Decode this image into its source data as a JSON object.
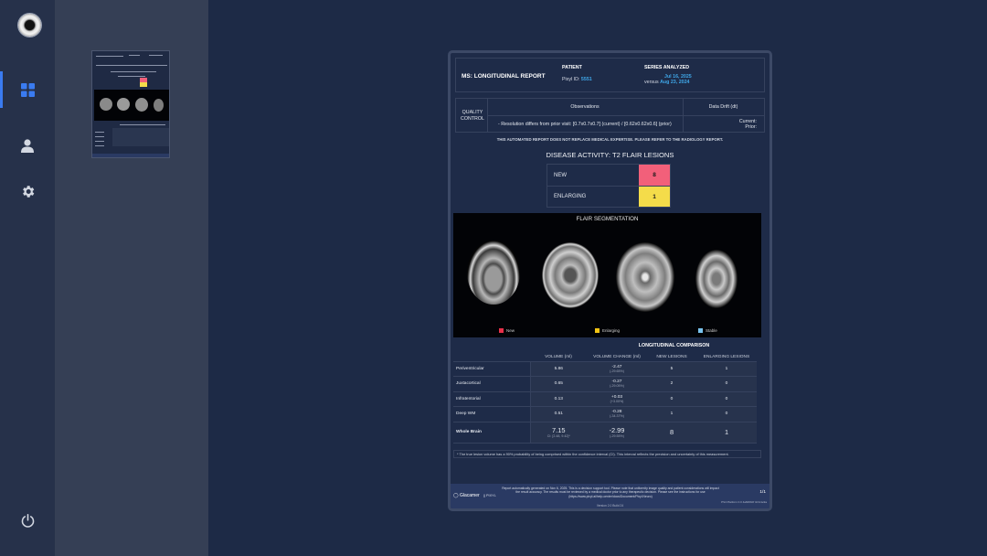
{
  "report": {
    "title": "MS: LONGITUDINAL REPORT",
    "patient_label": "PATIENT",
    "patient_id_label": "Pixyl ID:",
    "patient_id": "5551",
    "series_label": "SERIES ANALYZED",
    "series_current": "Jul 16, 2025",
    "series_versus": "versus",
    "series_prior": "Aug 23, 2024",
    "qc_label_1": "QUALITY",
    "qc_label_2": "CONTROL",
    "qc_obs_header": "Observations",
    "qc_drift_header": "Data Drift (dt)",
    "qc_observation": "- Resolution differs from prior visit: [0.7x0.7x0.7] (current) / [0.62x0.62x0.6] (prior)",
    "qc_drift_current": "Current:",
    "qc_drift_prior": "Prior:",
    "disclaimer": "THIS AUTOMATED REPORT DOES NOT REPLACE MEDICAL EXPERTISE. PLEASE REFER TO THE RADIOLOGY REPORT.",
    "activity_title": "DISEASE ACTIVITY: T2 FLAIR LESIONS",
    "activity": [
      {
        "label": "NEW",
        "value": "8",
        "color": "#f2607a"
      },
      {
        "label": "ENLARGING",
        "value": "1",
        "color": "#f4dc4a"
      }
    ],
    "segmentation_title": "FLAIR SEGMENTATION",
    "legend": [
      {
        "label": "New",
        "color": "#e8304a"
      },
      {
        "label": "Enlarging",
        "color": "#f2c414"
      },
      {
        "label": "Stable",
        "color": "#7ac3ee"
      }
    ],
    "comparison_title": "LONGITUDINAL COMPARISON",
    "comparison_headers": [
      "VOLUME (ml)",
      "VOLUME CHANGE (ml)",
      "NEW LESIONS",
      "ENLARGING LESIONS"
    ],
    "comparison_rows": [
      {
        "name": "Periventricular",
        "volume": "5.86",
        "change": "-2.47",
        "change_pct": "(-29.65%)",
        "new": "5",
        "enlarging": "1"
      },
      {
        "name": "Juxtacortical",
        "volume": "0.65",
        "change": "-0.27",
        "change_pct": "(-29.05%)",
        "new": "2",
        "enlarging": "0"
      },
      {
        "name": "Infratentorial",
        "volume": "0.13",
        "change": "+0.03",
        "change_pct": "(+3.00%)",
        "new": "0",
        "enlarging": "0"
      },
      {
        "name": "Deep WM",
        "volume": "0.51",
        "change": "-0.28",
        "change_pct": "(-34.37%)",
        "new": "1",
        "enlarging": "0"
      }
    ],
    "comparison_total": {
      "name": "Whole Brain",
      "volume": "7.15",
      "volume_ci": "CI: [2.48, 9.42]*",
      "change": "-2.99",
      "change_pct": "(-29.55%)",
      "new": "8",
      "enlarging": "1"
    },
    "footnote": "* The true lesion volume has a 90% probability of being comprised within the confidence interval (CI). This interval reflects the precision and uncertainty of this measurement.",
    "footer_logo": "Glacamer",
    "footer_logo2": "|| PIXYL",
    "footer_text": "Report automatically generated on Nov 6, 2025. This is a decision support tool. Please note that uniformity image quality and patient considerations will impact the result accuracy. The results must be reviewed by a medical doctor prior to any therapeutic decision. Please see the instructions for use (https://www.pixyl.ai/help-center/docs/Document/Pixyl.Neuro)",
    "footer_code": "Version 2.0 Build 24",
    "footer_page": "1/1",
    "footer_id": "PS4 Platform 0.0 4a8d6b0f 3c3c1e9a"
  }
}
